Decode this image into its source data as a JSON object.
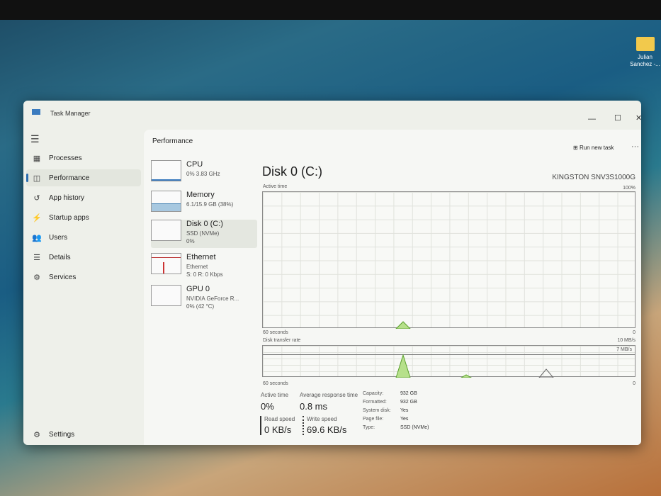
{
  "desktop": {
    "icon_label": "Julian Sanchez -..."
  },
  "window": {
    "title": "Task Manager",
    "minimize": "—",
    "maximize": "☐",
    "close": "✕"
  },
  "sidebar": {
    "items": [
      {
        "label": "Processes",
        "icon": "▦"
      },
      {
        "label": "Performance",
        "icon": "◫"
      },
      {
        "label": "App history",
        "icon": "↺"
      },
      {
        "label": "Startup apps",
        "icon": "⚡"
      },
      {
        "label": "Users",
        "icon": "👥"
      },
      {
        "label": "Details",
        "icon": "☰"
      },
      {
        "label": "Services",
        "icon": "⚙"
      }
    ],
    "settings": "Settings"
  },
  "header": {
    "title": "Performance",
    "run_new_task": "Run new task",
    "more": "···"
  },
  "perf_list": [
    {
      "name": "CPU",
      "line1": "0% 3.83 GHz",
      "line2": ""
    },
    {
      "name": "Memory",
      "line1": "6.1/15.9 GB (38%)",
      "line2": ""
    },
    {
      "name": "Disk 0 (C:)",
      "line1": "SSD (NVMe)",
      "line2": "0%"
    },
    {
      "name": "Ethernet",
      "line1": "Ethernet",
      "line2": "S: 0 R: 0 Kbps"
    },
    {
      "name": "GPU 0",
      "line1": "NVIDIA GeForce R...",
      "line2": "0% (42 °C)"
    }
  ],
  "disk": {
    "title": "Disk 0 (C:)",
    "model": "KINGSTON SNV3S1000G",
    "active_graph": {
      "label": "Active time",
      "max": "100%",
      "min": "0",
      "span": "60 seconds"
    },
    "transfer_graph": {
      "label": "Disk transfer rate",
      "max": "10 MB/s",
      "mid": "7 MB/s",
      "min": "0",
      "span": "60 seconds"
    },
    "stats": {
      "active_time_label": "Active time",
      "active_time": "0%",
      "avg_resp_label": "Average response time",
      "avg_resp": "0.8 ms",
      "read_label": "Read speed",
      "read": "0 KB/s",
      "write_label": "Write speed",
      "write": "69.6 KB/s"
    },
    "props": [
      {
        "k": "Capacity:",
        "v": "932 GB"
      },
      {
        "k": "Formatted:",
        "v": "932 GB"
      },
      {
        "k": "System disk:",
        "v": "Yes"
      },
      {
        "k": "Page file:",
        "v": "Yes"
      },
      {
        "k": "Type:",
        "v": "SSD (NVMe)"
      }
    ]
  },
  "colors": {
    "accent": "#2b6cb0",
    "disk_fill": "#b6e08a",
    "disk_line": "#5aa02c"
  }
}
